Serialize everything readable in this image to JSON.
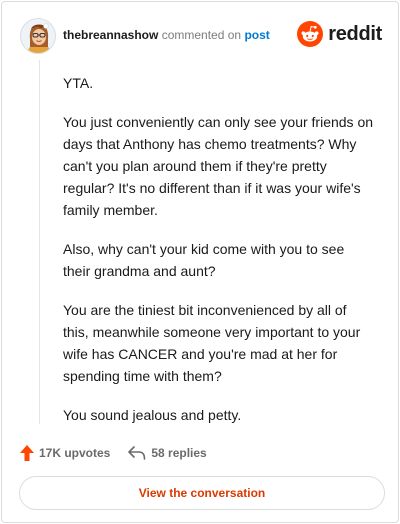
{
  "comment": {
    "username": "thebreannashow",
    "action_text": "commented on",
    "post_link_text": "post",
    "paragraphs": [
      "YTA.",
      "You just conveniently can only see your friends on days that Anthony has chemo treatments? Why can't you plan around them if they're pretty regular? It's no different than if it was your wife's family member.",
      "Also, why can't your kid come with you to see their grandma and aunt?",
      "You are the tiniest bit inconvenienced by all of this, meanwhile someone very important to your wife has CANCER and you're mad at her for spending time with them?",
      "You sound jealous and petty."
    ]
  },
  "brand": {
    "name": "reddit",
    "color": "#ff4500",
    "icon": "reddit-logo-icon"
  },
  "footer": {
    "upvotes": "17K upvotes",
    "replies": "58 replies",
    "upvote_icon": "upvote-arrow-icon",
    "reply_icon": "reply-arrow-icon",
    "upvote_color": "#ff4500"
  },
  "cta": {
    "label": "View the conversation",
    "color": "#d93a00"
  }
}
